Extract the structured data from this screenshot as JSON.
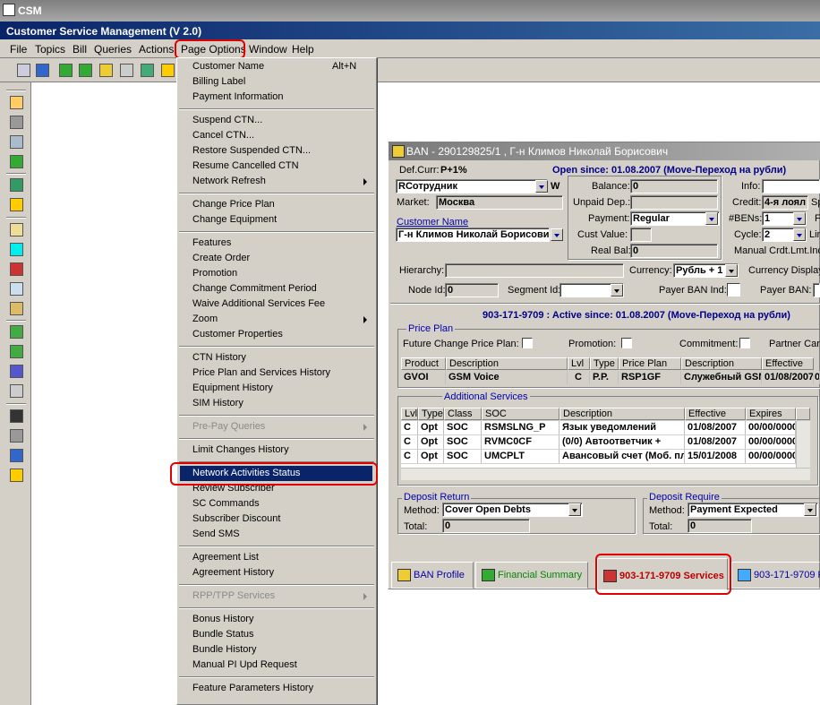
{
  "window": {
    "title": "CSM",
    "app_title": "Customer Service Management  (V 2.0)"
  },
  "menubar": [
    "File",
    "Topics",
    "Bill",
    "Queries",
    "Actions",
    "Page Options",
    "Window",
    "Help"
  ],
  "page_options_menu": {
    "customer_name": "Customer Name",
    "customer_name_shortcut": "Alt+N",
    "billing_label": "Billing Label",
    "payment_information": "Payment Information",
    "suspend_ctn": "Suspend CTN...",
    "cancel_ctn": "Cancel CTN...",
    "restore_suspended_ctn": "Restore Suspended CTN...",
    "resume_cancelled_ctn": "Resume Cancelled CTN",
    "network_refresh": "Network Refresh",
    "change_price_plan": "Change Price Plan",
    "change_equipment": "Change Equipment",
    "features": "Features",
    "create_order": "Create Order",
    "promotion": "Promotion",
    "change_commitment_period": "Change Commitment Period",
    "waive_additional_services_fee": "Waive Additional Services Fee",
    "zoom": "Zoom",
    "customer_properties": "Customer Properties",
    "ctn_history": "CTN History",
    "price_plan_and_services_history": "Price Plan and Services History",
    "equipment_history": "Equipment History",
    "sim_history": "SIM History",
    "pre_pay_queries": "Pre-Pay Queries",
    "limit_changes_history": "Limit Changes History",
    "network_activities_status": "Network Activities Status",
    "review_subscriber": "Review Subscriber",
    "sc_commands": "SC Commands",
    "subscriber_discount": "Subscriber Discount",
    "send_sms": "Send SMS",
    "agreement_list": "Agreement List",
    "agreement_history": "Agreement History",
    "rpp_tpp_services": "RPP/TPP Services",
    "bonus_history": "Bonus History",
    "bundle_status": "Bundle Status",
    "bundle_history": "Bundle History",
    "manual_pi_upd_request": "Manual PI Upd Request",
    "feature_parameters_history": "Feature Parameters History"
  },
  "ban": {
    "title": "BAN - 290129825/1 , Г-н Климов Николай Борисович",
    "def_curr_label": "Def.Curr:",
    "def_curr": "P+1%",
    "open_since": "Open since: 01.08.2007 (Move-Переход на рубли)",
    "account_type": "RСотрудник",
    "account_type_suffix": "W",
    "market_label": "Market:",
    "market": "Москва",
    "customer_name_label": "Customer Name",
    "customer_name": "Г-н Климов Николай Борисович",
    "balance_label": "Balance:",
    "balance": "0",
    "unpaid_dep_label": "Unpaid Dep.:",
    "unpaid_dep": "",
    "payment_label": "Payment:",
    "payment": "Regular",
    "cust_value_label": "Cust Value:",
    "cust_value": "",
    "real_bal_label": "Real Bal:",
    "real_bal": "0",
    "info_label": "Info:",
    "credit_label": "Credit:",
    "credit": "4-я лоял",
    "credit_cut": "Sp",
    "bens_label": "#BENs:",
    "bens": "1",
    "bens_cut": "F",
    "cycle_label": "Cycle:",
    "cycle": "2",
    "cycle_cut": "Lin",
    "manual_crdt": "Manual Crdt.Lmt.Ind:",
    "hierarchy_label": "Hierarchy:",
    "currency_label": "Currency:",
    "currency": "Рубль + 1",
    "currency_display": "Currency Display",
    "node_id_label": "Node Id:",
    "node_id": "0",
    "segment_id_label": "Segment Id:",
    "payer_ban_ind_label": "Payer BAN Ind:",
    "payer_ban_label": "Payer BAN:",
    "ctn_header": "903-171-9709 : Active since: 01.08.2007 (Move-Переход на рубли)",
    "price_plan_group": "Price Plan",
    "future_change_label": "Future Change Price Plan:",
    "promotion_label": "Promotion:",
    "commitment_label": "Commitment:",
    "partner_card_label": "Partner Card",
    "pp_headers": [
      "Product",
      "Description",
      "Lvl",
      "Type",
      "Price Plan",
      "Description",
      "Effective"
    ],
    "pp_row": [
      "GVOI",
      "GSM Voice",
      "C",
      "P.P.",
      "RSP1GF",
      "Служебный GSM",
      "01/08/2007",
      "0"
    ],
    "additional_services_label": "Additional Services",
    "as_headers": [
      "Lvl",
      "Type",
      "Class",
      "SOC",
      "Description",
      "Effective",
      "Expires"
    ],
    "as_rows": [
      [
        "C",
        "Opt",
        "SOC",
        "RSMSLNG_P",
        "Язык уведомлений",
        "01/08/2007",
        "00/00/0000"
      ],
      [
        "C",
        "Opt",
        "SOC",
        "RVMC0CF",
        "(0/0) Автоответчик +",
        "01/08/2007",
        "00/00/0000"
      ],
      [
        "C",
        "Opt",
        "SOC",
        "UMCPLT",
        "Авансовый счет (Моб. пл",
        "15/01/2008",
        "00/00/0000"
      ]
    ],
    "deposit_return_label": "Deposit Return",
    "deposit_require_label": "Deposit Require",
    "method_label": "Method:",
    "total_label": "Total:",
    "dep_return_method": "Cover Open Debts",
    "dep_return_total": "0",
    "dep_require_method": "Payment Expected",
    "dep_require_total": "0",
    "tabs": [
      "BAN Profile",
      "Financial Summary",
      "903-171-9709 Services",
      "903-171-9709 F"
    ]
  }
}
